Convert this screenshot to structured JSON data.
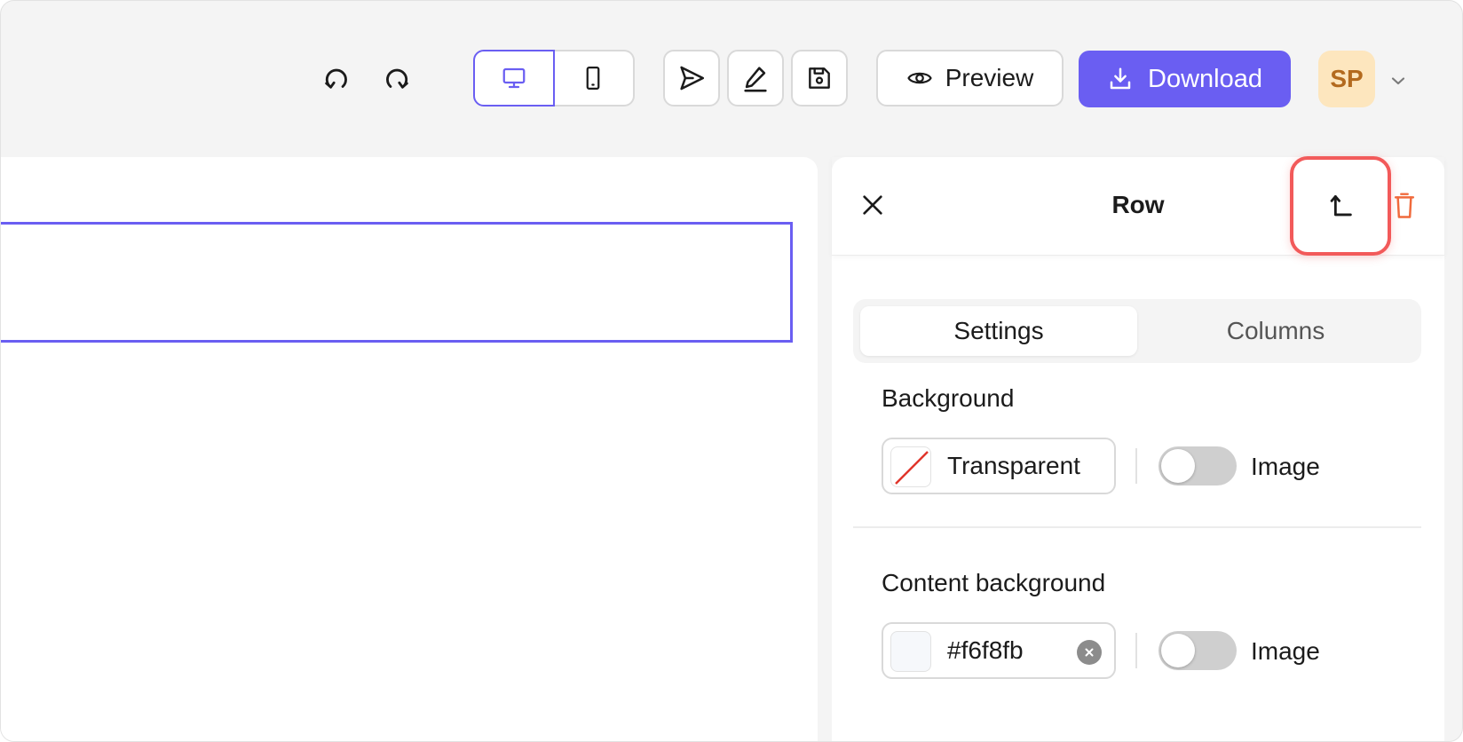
{
  "toolbar": {
    "undo_icon": "undo-icon",
    "redo_icon": "redo-icon",
    "view_desktop_icon": "monitor-icon",
    "view_mobile_icon": "smartphone-icon",
    "send_icon": "send-icon",
    "edit_icon": "pen-icon",
    "save_icon": "floppy-disk-icon",
    "preview_label": "Preview",
    "download_label": "Download",
    "avatar_initials": "SP",
    "accent_color": "#6a5ef2"
  },
  "panel": {
    "title": "Row",
    "tabs": [
      {
        "label": "Settings",
        "active": true
      },
      {
        "label": "Columns",
        "active": false
      }
    ],
    "background": {
      "label": "Background",
      "value": "Transparent",
      "image_label": "Image",
      "image_enabled": false
    },
    "content_background": {
      "label": "Content background",
      "value": "#f6f8fb",
      "display_value": "#f6f8fb",
      "image_label": "Image",
      "image_enabled": false
    },
    "highlight_color": "#f25a5a",
    "delete_color": "#f06a3c"
  }
}
